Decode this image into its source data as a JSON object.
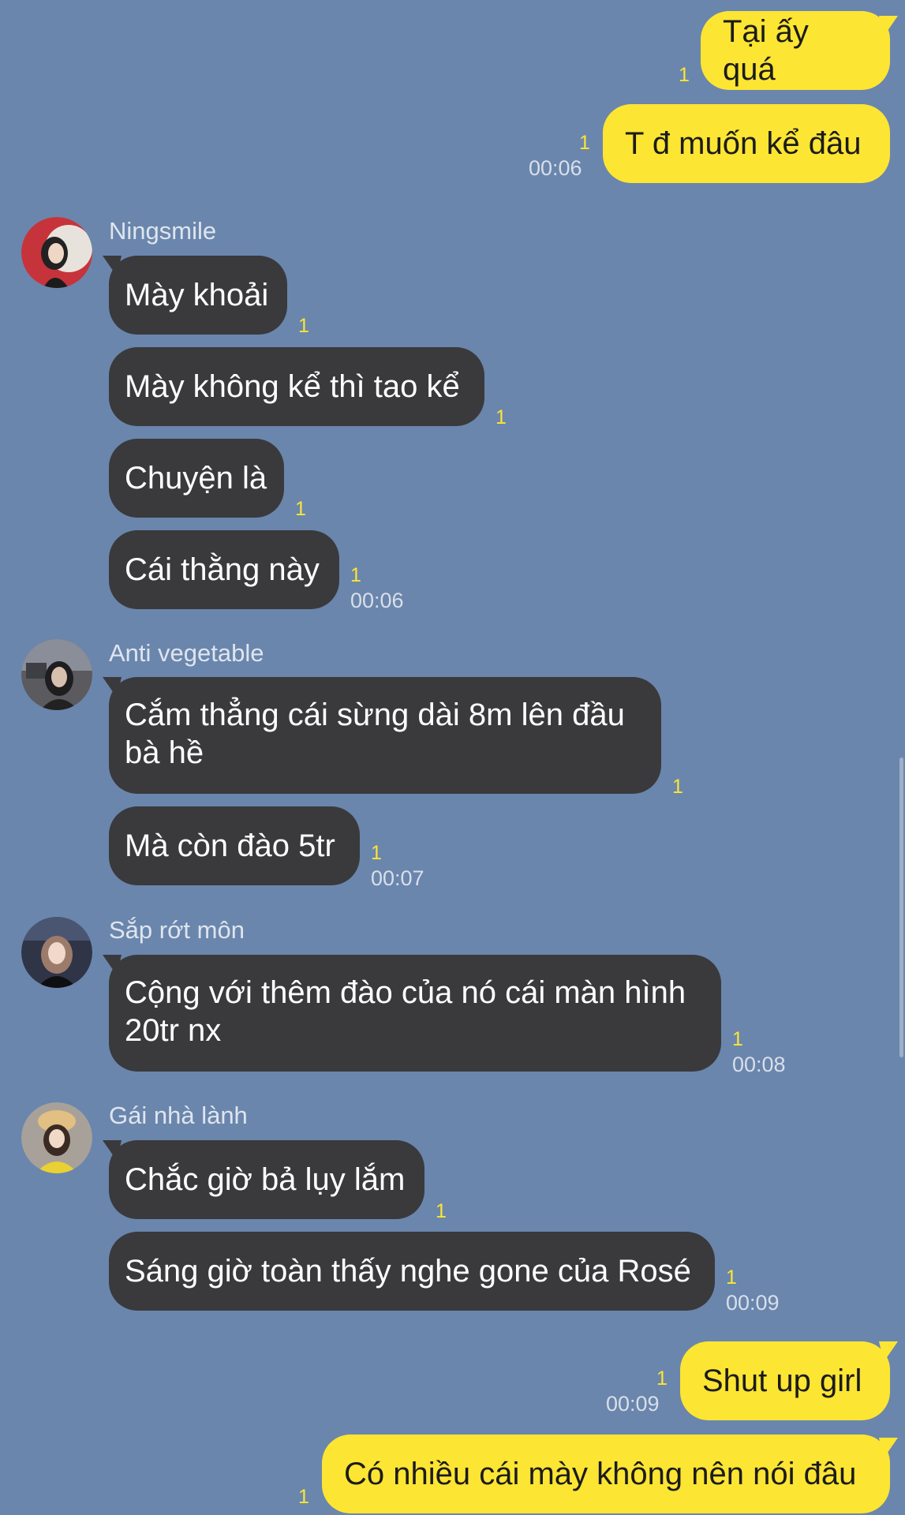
{
  "colors": {
    "background": "#6a86ad",
    "my_bubble": "#fde533",
    "their_bubble": "#3a3a3c",
    "read_count": "#fde533"
  },
  "messages": {
    "m1": {
      "text": "Tại ấy quá",
      "read": "1"
    },
    "m2": {
      "text": "T đ muốn kể đâu",
      "read": "1",
      "time": "00:06"
    },
    "g1": {
      "sender": "Ningsmile",
      "avatar_icon": "user-avatar-icon",
      "b1": {
        "text": "Mày khoải",
        "read": "1"
      },
      "b2": {
        "text": "Mày không kể thì tao kể",
        "read": "1"
      },
      "b3": {
        "text": "Chuyện là",
        "read": "1"
      },
      "b4": {
        "text": "Cái thằng này",
        "read": "1",
        "time": "00:06"
      }
    },
    "g2": {
      "sender": "Anti vegetable",
      "avatar_icon": "user-avatar-icon",
      "b1": {
        "line1": "Cắm thẳng cái sừng dài 8m lên đầu",
        "line2": "bà hề",
        "read": "1"
      },
      "b2": {
        "text": "Mà còn đào 5tr",
        "read": "1",
        "time": "00:07"
      }
    },
    "g3": {
      "sender": "Sắp rớt môn",
      "avatar_icon": "user-avatar-icon",
      "b1": {
        "line1": "Cộng với thêm đào của nó cái màn hình",
        "line2": "20tr nx",
        "read": "1",
        "time": "00:08"
      }
    },
    "g4": {
      "sender": "Gái nhà lành",
      "avatar_icon": "user-avatar-icon",
      "b1": {
        "text": "Chắc giờ bả lụy lắm",
        "read": "1"
      },
      "b2": {
        "text": "Sáng giờ toàn thấy nghe gone của Rosé",
        "read": "1",
        "time": "00:09"
      }
    },
    "m3": {
      "text": "Shut up girl",
      "read": "1",
      "time": "00:09"
    },
    "m4": {
      "text": "Có nhiều cái mày không nên nói đâu",
      "read": "1"
    }
  }
}
